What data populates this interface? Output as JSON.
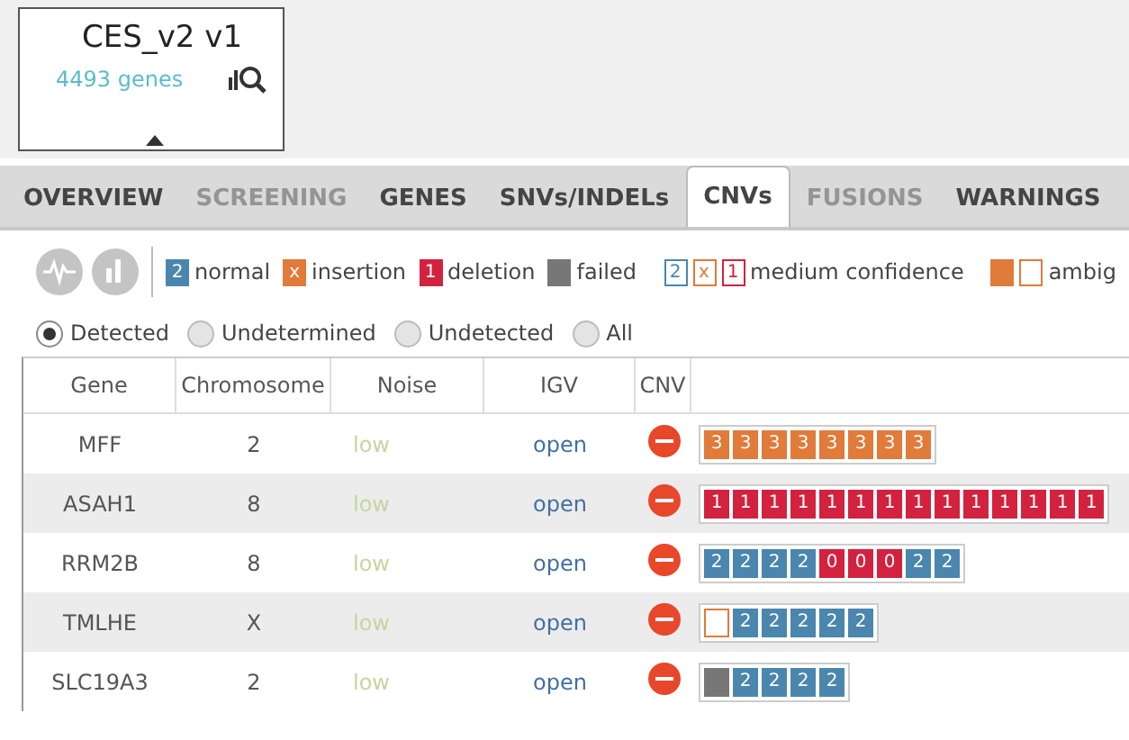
{
  "panel": {
    "title": "CES_v2 v1",
    "subtitle": "4493 genes"
  },
  "tabs": [
    {
      "label": "OVERVIEW",
      "selected": false,
      "disabled": false
    },
    {
      "label": "SCREENING",
      "selected": false,
      "disabled": true
    },
    {
      "label": "GENES",
      "selected": false,
      "disabled": false
    },
    {
      "label": "SNVs/INDELs",
      "selected": false,
      "disabled": false
    },
    {
      "label": "CNVs",
      "selected": true,
      "disabled": false
    },
    {
      "label": "FUSIONS",
      "selected": false,
      "disabled": true
    },
    {
      "label": "WARNINGS",
      "selected": false,
      "disabled": false
    }
  ],
  "legend": [
    {
      "swatches": [
        {
          "kind": "normal",
          "text": "2",
          "outlined": false
        }
      ],
      "label": "normal"
    },
    {
      "swatches": [
        {
          "kind": "insertion",
          "text": "x",
          "outlined": false
        }
      ],
      "label": "insertion"
    },
    {
      "swatches": [
        {
          "kind": "deletion",
          "text": "1",
          "outlined": false
        }
      ],
      "label": "deletion"
    },
    {
      "swatches": [
        {
          "kind": "failed",
          "outlined": false
        }
      ],
      "label": "failed"
    },
    {
      "swatches": [
        {
          "kind": "normal",
          "text": "2",
          "outlined": true
        },
        {
          "kind": "insertion",
          "text": "x",
          "outlined": true
        },
        {
          "kind": "deletion",
          "text": "1",
          "outlined": true
        }
      ],
      "label": "medium confidence"
    },
    {
      "swatches": [
        {
          "kind": "insertion",
          "outlined": false
        },
        {
          "kind": "insertion",
          "outlined": true
        }
      ],
      "label": "ambig"
    }
  ],
  "filters": [
    {
      "label": "Detected",
      "selected": true
    },
    {
      "label": "Undetermined",
      "selected": false
    },
    {
      "label": "Undetected",
      "selected": false
    },
    {
      "label": "All",
      "selected": false
    }
  ],
  "table": {
    "columns": [
      "Gene",
      "Chromosome",
      "Noise",
      "IGV",
      "CNV"
    ],
    "rows": [
      {
        "gene": "MFF",
        "chromosome": "2",
        "noise": "low",
        "igv": "open",
        "cells": [
          {
            "kind": "insertion",
            "text": "3"
          },
          {
            "kind": "insertion",
            "text": "3"
          },
          {
            "kind": "insertion",
            "text": "3"
          },
          {
            "kind": "insertion",
            "text": "3"
          },
          {
            "kind": "insertion",
            "text": "3"
          },
          {
            "kind": "insertion",
            "text": "3"
          },
          {
            "kind": "insertion",
            "text": "3"
          },
          {
            "kind": "insertion",
            "text": "3"
          }
        ]
      },
      {
        "gene": "ASAH1",
        "chromosome": "8",
        "noise": "low",
        "igv": "open",
        "cells": [
          {
            "kind": "deletion",
            "text": "1"
          },
          {
            "kind": "deletion",
            "text": "1"
          },
          {
            "kind": "deletion",
            "text": "1"
          },
          {
            "kind": "deletion",
            "text": "1"
          },
          {
            "kind": "deletion",
            "text": "1"
          },
          {
            "kind": "deletion",
            "text": "1"
          },
          {
            "kind": "deletion",
            "text": "1"
          },
          {
            "kind": "deletion",
            "text": "1"
          },
          {
            "kind": "deletion",
            "text": "1"
          },
          {
            "kind": "deletion",
            "text": "1"
          },
          {
            "kind": "deletion",
            "text": "1"
          },
          {
            "kind": "deletion",
            "text": "1"
          },
          {
            "kind": "deletion",
            "text": "1"
          },
          {
            "kind": "deletion",
            "text": "1"
          }
        ]
      },
      {
        "gene": "RRM2B",
        "chromosome": "8",
        "noise": "low",
        "igv": "open",
        "cells": [
          {
            "kind": "normal",
            "text": "2"
          },
          {
            "kind": "normal",
            "text": "2"
          },
          {
            "kind": "normal",
            "text": "2"
          },
          {
            "kind": "normal",
            "text": "2"
          },
          {
            "kind": "deletion",
            "text": "0"
          },
          {
            "kind": "deletion",
            "text": "0"
          },
          {
            "kind": "deletion",
            "text": "0"
          },
          {
            "kind": "normal",
            "text": "2"
          },
          {
            "kind": "normal",
            "text": "2"
          }
        ]
      },
      {
        "gene": "TMLHE",
        "chromosome": "X",
        "noise": "low",
        "igv": "open",
        "cells": [
          {
            "kind": "ambiguous"
          },
          {
            "kind": "normal",
            "text": "2"
          },
          {
            "kind": "normal",
            "text": "2"
          },
          {
            "kind": "normal",
            "text": "2"
          },
          {
            "kind": "normal",
            "text": "2"
          },
          {
            "kind": "normal",
            "text": "2"
          }
        ]
      },
      {
        "gene": "SLC19A3",
        "chromosome": "2",
        "noise": "low",
        "igv": "open",
        "cells": [
          {
            "kind": "failed"
          },
          {
            "kind": "normal",
            "text": "2"
          },
          {
            "kind": "normal",
            "text": "2"
          },
          {
            "kind": "normal",
            "text": "2"
          },
          {
            "kind": "normal",
            "text": "2"
          }
        ]
      }
    ]
  }
}
